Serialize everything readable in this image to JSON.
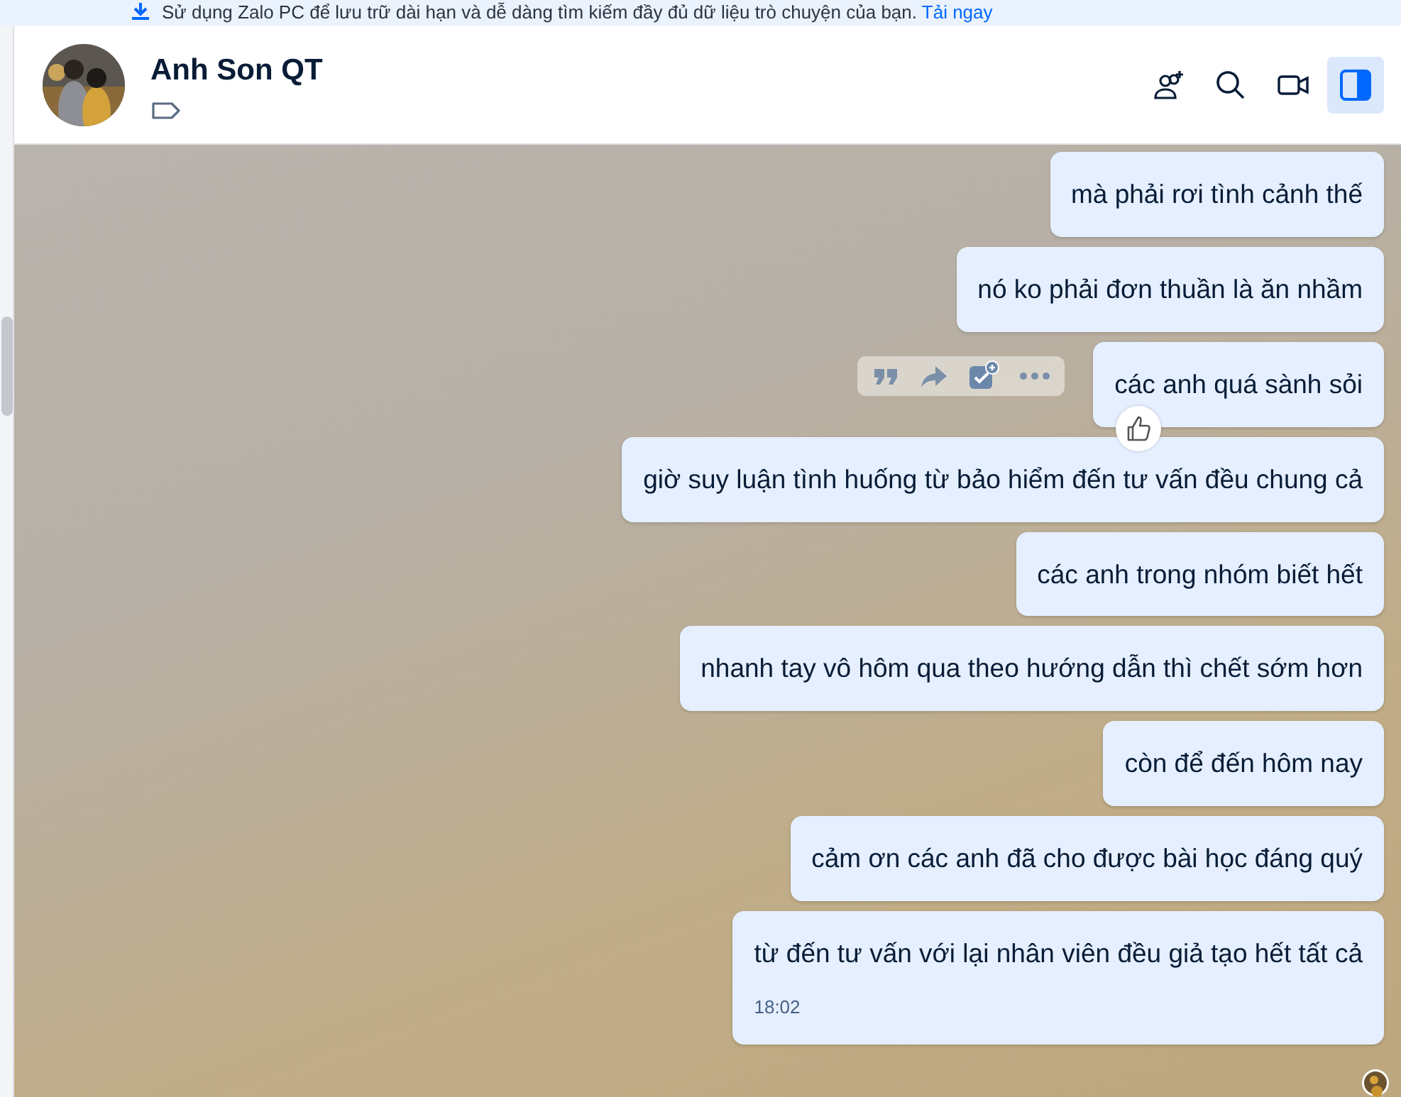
{
  "banner": {
    "text": "Sử dụng Zalo PC để lưu trữ dài hạn và dễ dàng tìm kiếm đầy đủ dữ liệu trò chuyện của bạn.",
    "link": "Tải ngay"
  },
  "contact": {
    "name": "Anh Son QT"
  },
  "header_actions": [
    {
      "kind": "add-member",
      "selected": false
    },
    {
      "kind": "search",
      "selected": false
    },
    {
      "kind": "video",
      "selected": false
    },
    {
      "kind": "panel",
      "selected": true
    }
  ],
  "messages": [
    {
      "text": "mà phải rơi tình cảnh thế",
      "hovered": false,
      "reacted": false
    },
    {
      "text": "nó ko phải đơn thuần là ăn nhầm",
      "hovered": false,
      "reacted": false
    },
    {
      "text": "các anh quá sành sỏi",
      "hovered": true,
      "reacted": true
    },
    {
      "text": "giờ suy luận tình huống từ bảo hiểm đến tư vấn đều chung cả",
      "hovered": false,
      "reacted": false
    },
    {
      "text": "các anh trong nhóm biết hết",
      "hovered": false,
      "reacted": false
    },
    {
      "text": "nhanh tay vô hôm qua theo hướng dẫn thì chết sớm hơn",
      "hovered": false,
      "reacted": false
    },
    {
      "text": "còn để đến hôm nay",
      "hovered": false,
      "reacted": false
    },
    {
      "text": "cảm ơn các anh đã cho được bài học đáng quý",
      "hovered": false,
      "reacted": false
    },
    {
      "text": "từ đến tư vấn với lại nhân viên đều giả tạo hết tất cả",
      "hovered": false,
      "reacted": false,
      "time": "18:02"
    }
  ]
}
